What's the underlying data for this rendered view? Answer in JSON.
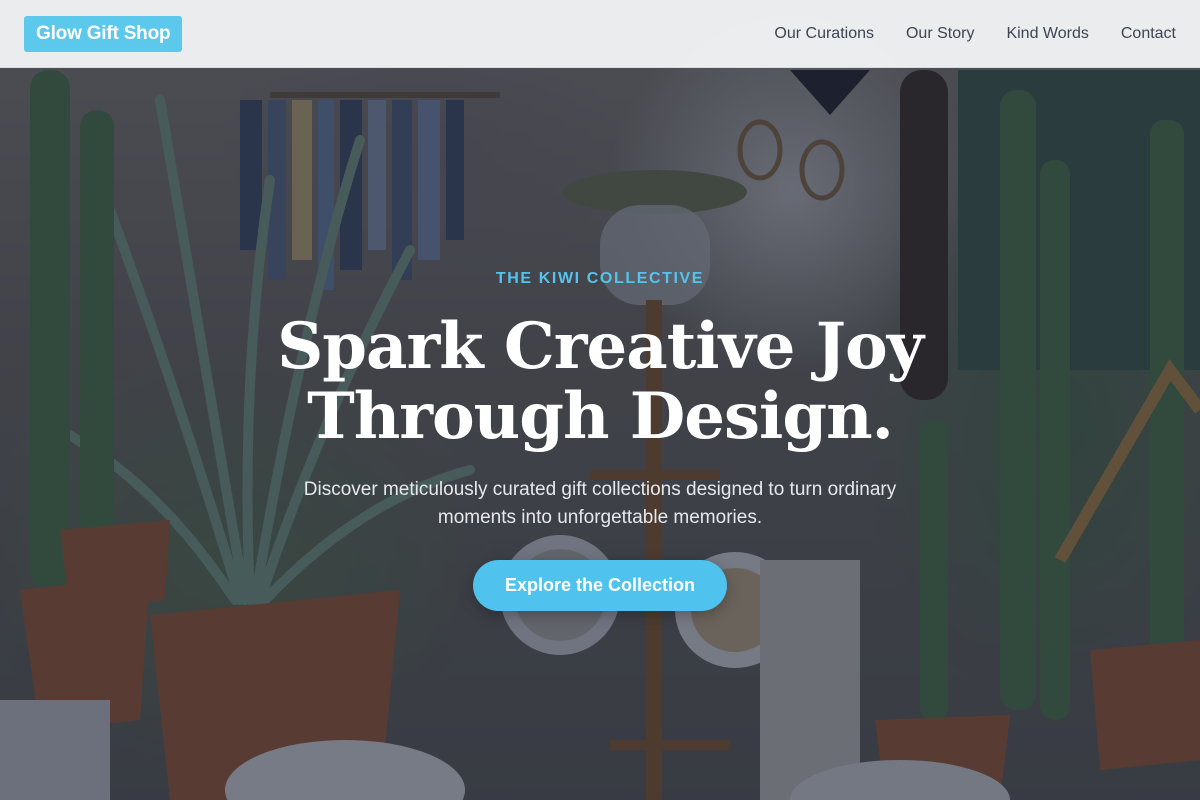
{
  "nav": {
    "brand": "Glow Gift Shop",
    "links": [
      {
        "label": "Our Curations"
      },
      {
        "label": "Our Story"
      },
      {
        "label": "Kind Words"
      },
      {
        "label": "Contact"
      }
    ]
  },
  "hero": {
    "eyebrow": "THE KIWI COLLECTIVE",
    "headline_line1": "Spark Creative Joy",
    "headline_line2": "Through Design.",
    "subtitle": "Discover meticulously curated gift collections designed to turn ordinary moments into unforgettable memories.",
    "cta_label": "Explore the Collection"
  },
  "colors": {
    "accent": "#4fc3ee",
    "brand_bg": "#5cc8ec",
    "nav_text": "#3c4554",
    "overlay": "#1c2234"
  }
}
